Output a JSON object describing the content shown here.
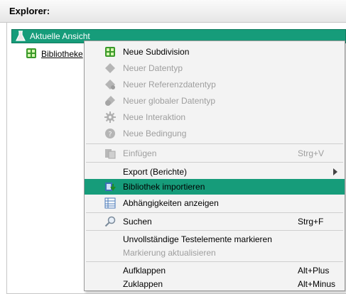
{
  "header": {
    "title": "Explorer:"
  },
  "tree": {
    "root_label": "Aktuelle Ansicht",
    "child_label": "Bibliotheke"
  },
  "menu": {
    "items": [
      {
        "label": "Neue Subdivision",
        "shortcut": "",
        "icon": "green-grid-icon",
        "disabled": false
      },
      {
        "label": "Neuer Datentyp",
        "shortcut": "",
        "icon": "diamond-icon",
        "disabled": true
      },
      {
        "label": "Neuer Referenzdatentyp",
        "shortcut": "",
        "icon": "diamond-link-icon",
        "disabled": true
      },
      {
        "label": "Neuer globaler Datentyp",
        "shortcut": "",
        "icon": "diamond-global-icon",
        "disabled": true
      },
      {
        "label": "Neue Interaktion",
        "shortcut": "",
        "icon": "gear-icon",
        "disabled": true
      },
      {
        "label": "Neue Bedingung",
        "shortcut": "",
        "icon": "question-icon",
        "disabled": true
      },
      {
        "label": "Einfügen",
        "shortcut": "Strg+V",
        "icon": "paste-icon",
        "disabled": true
      },
      {
        "label": "Export (Berichte)",
        "shortcut": "",
        "icon": "",
        "disabled": false,
        "submenu": true
      },
      {
        "label": "Bibliothek importieren",
        "shortcut": "",
        "icon": "import-library-icon",
        "disabled": false,
        "selected": true
      },
      {
        "label": "Abhängigkeiten anzeigen",
        "shortcut": "",
        "icon": "table-icon",
        "disabled": false
      },
      {
        "label": "Suchen",
        "shortcut": "Strg+F",
        "icon": "search-icon",
        "disabled": false
      },
      {
        "label": "Unvollständige Testelemente markieren",
        "shortcut": "",
        "icon": "",
        "disabled": false
      },
      {
        "label": "Markierung aktualisieren",
        "shortcut": "",
        "icon": "",
        "disabled": true
      },
      {
        "label": "Aufklappen",
        "shortcut": "Alt+Plus",
        "icon": "",
        "disabled": false
      },
      {
        "label": "Zuklappen",
        "shortcut": "Alt+Minus",
        "icon": "",
        "disabled": false
      }
    ]
  },
  "colors": {
    "selection": "#169c7a",
    "menu_bg": "#f3f3f3",
    "disabled_text": "#9e9e9e"
  }
}
